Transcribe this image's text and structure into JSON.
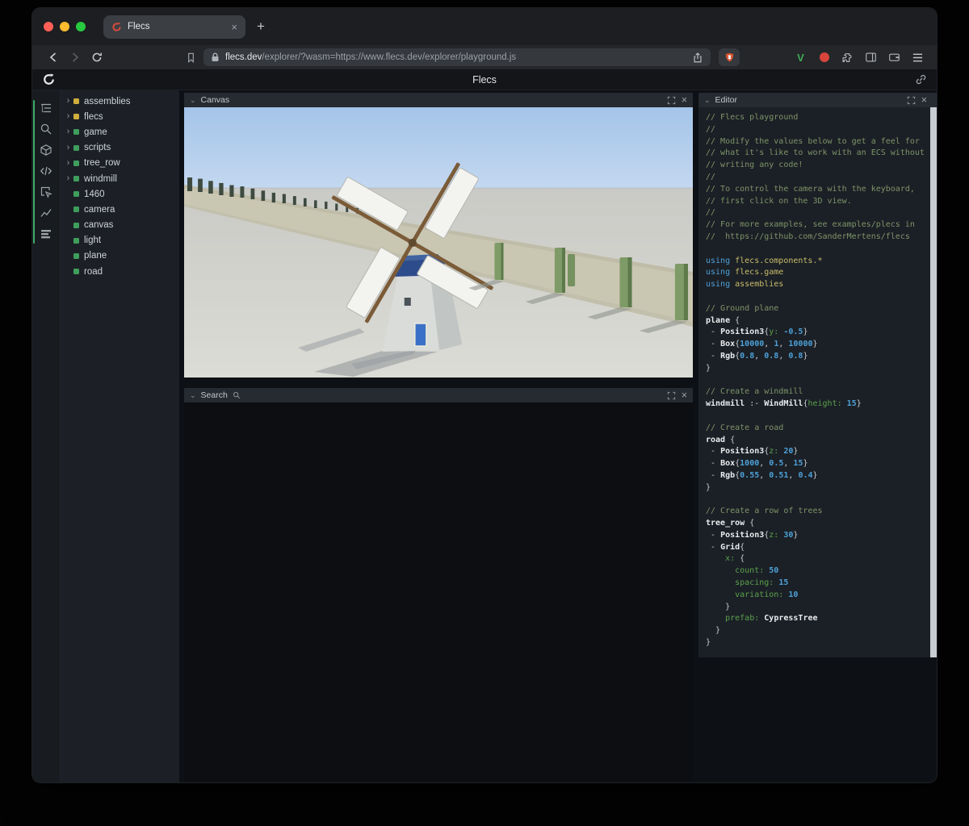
{
  "browser": {
    "tab_title": "Flecs",
    "tab_close_glyph": "×",
    "new_tab_glyph": "+",
    "url_host": "flecs.dev",
    "url_rest": "/explorer/?wasm=https://www.flecs.dev/explorer/playground.js",
    "v_badge": "V"
  },
  "header": {
    "title": "Flecs"
  },
  "rail_items": [
    "entity-tree",
    "search",
    "entities",
    "code",
    "inspect",
    "charts",
    "stats"
  ],
  "tree": {
    "chevron_glyph": "›",
    "items": [
      {
        "label": "assemblies",
        "color": "#cfae3d",
        "expandable": true
      },
      {
        "label": "flecs",
        "color": "#cfae3d",
        "expandable": true
      },
      {
        "label": "game",
        "color": "#3f9e5c",
        "expandable": true
      },
      {
        "label": "scripts",
        "color": "#3f9e5c",
        "expandable": true
      },
      {
        "label": "tree_row",
        "color": "#3f9e5c",
        "expandable": true
      },
      {
        "label": "windmill",
        "color": "#3f9e5c",
        "expandable": true
      },
      {
        "label": "1460",
        "color": "#3f9e5c",
        "expandable": false
      },
      {
        "label": "camera",
        "color": "#3f9e5c",
        "expandable": false
      },
      {
        "label": "canvas",
        "color": "#3f9e5c",
        "expandable": false
      },
      {
        "label": "light",
        "color": "#3f9e5c",
        "expandable": false
      },
      {
        "label": "plane",
        "color": "#3f9e5c",
        "expandable": false
      },
      {
        "label": "road",
        "color": "#3f9e5c",
        "expandable": false
      }
    ]
  },
  "panels": {
    "canvas_title": "Canvas",
    "search_title": "Search",
    "editor_title": "Editor",
    "collapse_glyph": "⌄",
    "close_glyph": "×"
  },
  "editor": {
    "lines": [
      [
        [
          "cm",
          "// Flecs playground"
        ]
      ],
      [
        [
          "cm",
          "//"
        ]
      ],
      [
        [
          "cm",
          "// Modify the values below to get a feel for"
        ]
      ],
      [
        [
          "cm",
          "// what it's like to work with an ECS without"
        ]
      ],
      [
        [
          "cm",
          "// writing any code!"
        ]
      ],
      [
        [
          "cm",
          "//"
        ]
      ],
      [
        [
          "cm",
          "// To control the camera with the keyboard,"
        ]
      ],
      [
        [
          "cm",
          "// first click on the 3D view."
        ]
      ],
      [
        [
          "cm",
          "//"
        ]
      ],
      [
        [
          "cm",
          "// For more examples, see examples/plecs in"
        ]
      ],
      [
        [
          "cm",
          "//  https://github.com/SanderMertens/flecs"
        ]
      ],
      [],
      [
        [
          "kw",
          "using "
        ],
        [
          "mod",
          "flecs.components.*"
        ]
      ],
      [
        [
          "kw",
          "using "
        ],
        [
          "mod",
          "flecs.game"
        ]
      ],
      [
        [
          "kw",
          "using "
        ],
        [
          "mod",
          "assemblies"
        ]
      ],
      [],
      [
        [
          "cm",
          "// Ground plane"
        ]
      ],
      [
        [
          "id",
          "plane"
        ],
        [
          "pn",
          " {"
        ]
      ],
      [
        [
          "pn",
          " - "
        ],
        [
          "id",
          "Position3"
        ],
        [
          "pn",
          "{"
        ],
        [
          "key",
          "y:"
        ],
        [
          "pn",
          " "
        ],
        [
          "num",
          "-0.5"
        ],
        [
          "pn",
          "}"
        ]
      ],
      [
        [
          "pn",
          " - "
        ],
        [
          "id",
          "Box"
        ],
        [
          "pn",
          "{"
        ],
        [
          "num",
          "10000"
        ],
        [
          "pn",
          ", "
        ],
        [
          "num",
          "1"
        ],
        [
          "pn",
          ", "
        ],
        [
          "num",
          "10000"
        ],
        [
          "pn",
          "}"
        ]
      ],
      [
        [
          "pn",
          " - "
        ],
        [
          "id",
          "Rgb"
        ],
        [
          "pn",
          "{"
        ],
        [
          "num",
          "0.8"
        ],
        [
          "pn",
          ", "
        ],
        [
          "num",
          "0.8"
        ],
        [
          "pn",
          ", "
        ],
        [
          "num",
          "0.8"
        ],
        [
          "pn",
          "}"
        ]
      ],
      [
        [
          "pn",
          "}"
        ]
      ],
      [],
      [
        [
          "cm",
          "// Create a windmill"
        ]
      ],
      [
        [
          "id",
          "windmill"
        ],
        [
          "pn",
          " :- "
        ],
        [
          "id",
          "WindMill"
        ],
        [
          "pn",
          "{"
        ],
        [
          "key",
          "height:"
        ],
        [
          "pn",
          " "
        ],
        [
          "num",
          "15"
        ],
        [
          "pn",
          "}"
        ]
      ],
      [],
      [
        [
          "cm",
          "// Create a road"
        ]
      ],
      [
        [
          "id",
          "road"
        ],
        [
          "pn",
          " {"
        ]
      ],
      [
        [
          "pn",
          " - "
        ],
        [
          "id",
          "Position3"
        ],
        [
          "pn",
          "{"
        ],
        [
          "key",
          "z:"
        ],
        [
          "pn",
          " "
        ],
        [
          "num",
          "20"
        ],
        [
          "pn",
          "}"
        ]
      ],
      [
        [
          "pn",
          " - "
        ],
        [
          "id",
          "Box"
        ],
        [
          "pn",
          "{"
        ],
        [
          "num",
          "1000"
        ],
        [
          "pn",
          ", "
        ],
        [
          "num",
          "0.5"
        ],
        [
          "pn",
          ", "
        ],
        [
          "num",
          "15"
        ],
        [
          "pn",
          "}"
        ]
      ],
      [
        [
          "pn",
          " - "
        ],
        [
          "id",
          "Rgb"
        ],
        [
          "pn",
          "{"
        ],
        [
          "num",
          "0.55"
        ],
        [
          "pn",
          ", "
        ],
        [
          "num",
          "0.51"
        ],
        [
          "pn",
          ", "
        ],
        [
          "num",
          "0.4"
        ],
        [
          "pn",
          "}"
        ]
      ],
      [
        [
          "pn",
          "}"
        ]
      ],
      [],
      [
        [
          "cm",
          "// Create a row of trees"
        ]
      ],
      [
        [
          "id",
          "tree_row"
        ],
        [
          "pn",
          " {"
        ]
      ],
      [
        [
          "pn",
          " - "
        ],
        [
          "id",
          "Position3"
        ],
        [
          "pn",
          "{"
        ],
        [
          "key",
          "z:"
        ],
        [
          "pn",
          " "
        ],
        [
          "num",
          "30"
        ],
        [
          "pn",
          "}"
        ]
      ],
      [
        [
          "pn",
          " - "
        ],
        [
          "id",
          "Grid"
        ],
        [
          "pn",
          "{"
        ]
      ],
      [
        [
          "pn",
          "    "
        ],
        [
          "key",
          "x:"
        ],
        [
          "pn",
          " {"
        ]
      ],
      [
        [
          "pn",
          "      "
        ],
        [
          "key",
          "count:"
        ],
        [
          "pn",
          " "
        ],
        [
          "num",
          "50"
        ]
      ],
      [
        [
          "pn",
          "      "
        ],
        [
          "key",
          "spacing:"
        ],
        [
          "pn",
          " "
        ],
        [
          "num",
          "15"
        ]
      ],
      [
        [
          "pn",
          "      "
        ],
        [
          "key",
          "variation:"
        ],
        [
          "pn",
          " "
        ],
        [
          "num",
          "10"
        ]
      ],
      [
        [
          "pn",
          "    }"
        ]
      ],
      [
        [
          "pn",
          "    "
        ],
        [
          "key",
          "prefab:"
        ],
        [
          "pn",
          " "
        ],
        [
          "id",
          "CypressTree"
        ]
      ],
      [
        [
          "pn",
          "  }"
        ]
      ],
      [
        [
          "pn",
          "}"
        ]
      ]
    ]
  }
}
